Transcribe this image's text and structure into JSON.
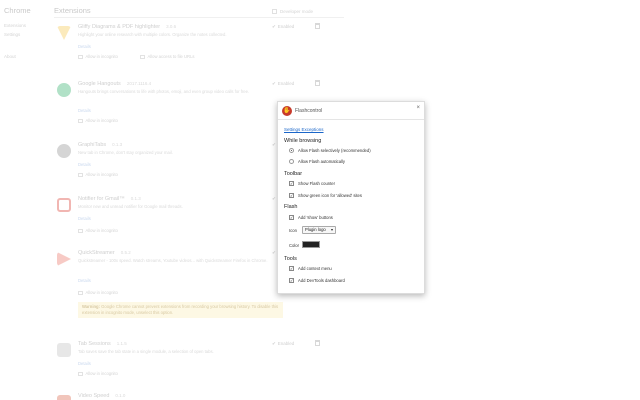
{
  "nav": {
    "brand": "Chrome",
    "items": [
      "Extensions",
      "Settings",
      "About"
    ]
  },
  "header": {
    "title": "Extensions",
    "developer_mode": "Developer mode"
  },
  "extensions": [
    {
      "name": "Gliffy Diagrams & PDF highlighter",
      "version": "3.0.6",
      "description": "Highlight your online research with multiple colors. Organize the notes collected.",
      "details": "Details",
      "option1": "Allow in incognito",
      "option2": "Allow access to file URLs",
      "enabled": "Enabled",
      "color": "#f3c440"
    },
    {
      "name": "Google Hangouts",
      "version": "2017.1116.4",
      "description": "Hangouts brings conversations to life with photos, emoji, and even group video calls for free.",
      "details": "Details",
      "option1": "Allow in incognito",
      "enabled": "Enabled",
      "color": "#1faa5e"
    },
    {
      "name": "GraphiTabs",
      "version": "0.1.3",
      "description": "New tab in Chrome, don't stay organized your mail.",
      "details": "Details",
      "option1": "Allow in incognito",
      "enabled": "Enabled",
      "color": "#888888"
    },
    {
      "name": "Notifier for Gmail™",
      "version": "0.1.3",
      "description": "Monitor new and unread notifier for Google mail threads.",
      "details": "Details",
      "option1": "Allow in incognito",
      "enabled": "Enabled",
      "color": "#d93025"
    },
    {
      "name": "QuickStreamer",
      "version": "0.5.2",
      "description": "Quickstreamer - 100x speed. Watch streams, Youtube videos... with Quickstreamer Firefox in Chrome.",
      "details": "Details",
      "option1": "Allow in incognito",
      "warning_strong": "Warning:",
      "warning": "Google Chrome cannot prevent extensions from recording your browsing history. To disable this extension in incognito mode, unselect this option.",
      "enabled": "Enabled",
      "color": "#e9685a"
    },
    {
      "name": "Tab Sessions",
      "version": "1.1.5",
      "description": "Tab saves save the tab state in a single module, a selection of open tabs.",
      "details": "Details",
      "option1": "Allow in incognito",
      "enabled": "Enabled",
      "color": "#bbbbbb"
    },
    {
      "name": "Video Speed",
      "version": "0.1.0",
      "description": "",
      "details": "",
      "option1": "",
      "enabled": "",
      "color": "#d65a3c"
    }
  ],
  "popup": {
    "title": "Flashcontrol",
    "close": "×",
    "settings_link": "Settings Exceptions",
    "while_browsing": {
      "heading": "While browsing",
      "option_selective": "Allow Flash selectively (recommended)",
      "option_auto": "Allow Flash automatically"
    },
    "toolbar": {
      "heading": "Toolbar",
      "show_counter": "Show Flash counter",
      "show_green": "Show green icon for 'allowed' sites"
    },
    "flash": {
      "heading": "Flash",
      "add_view": "Add 'show' buttons",
      "icon_label": "Icon",
      "icon_value": "Plugin logo",
      "color_label": "Color"
    },
    "tools": {
      "heading": "Tools",
      "context_menu": "Add context menu",
      "devtools": "Add DevTools dashboard"
    }
  }
}
